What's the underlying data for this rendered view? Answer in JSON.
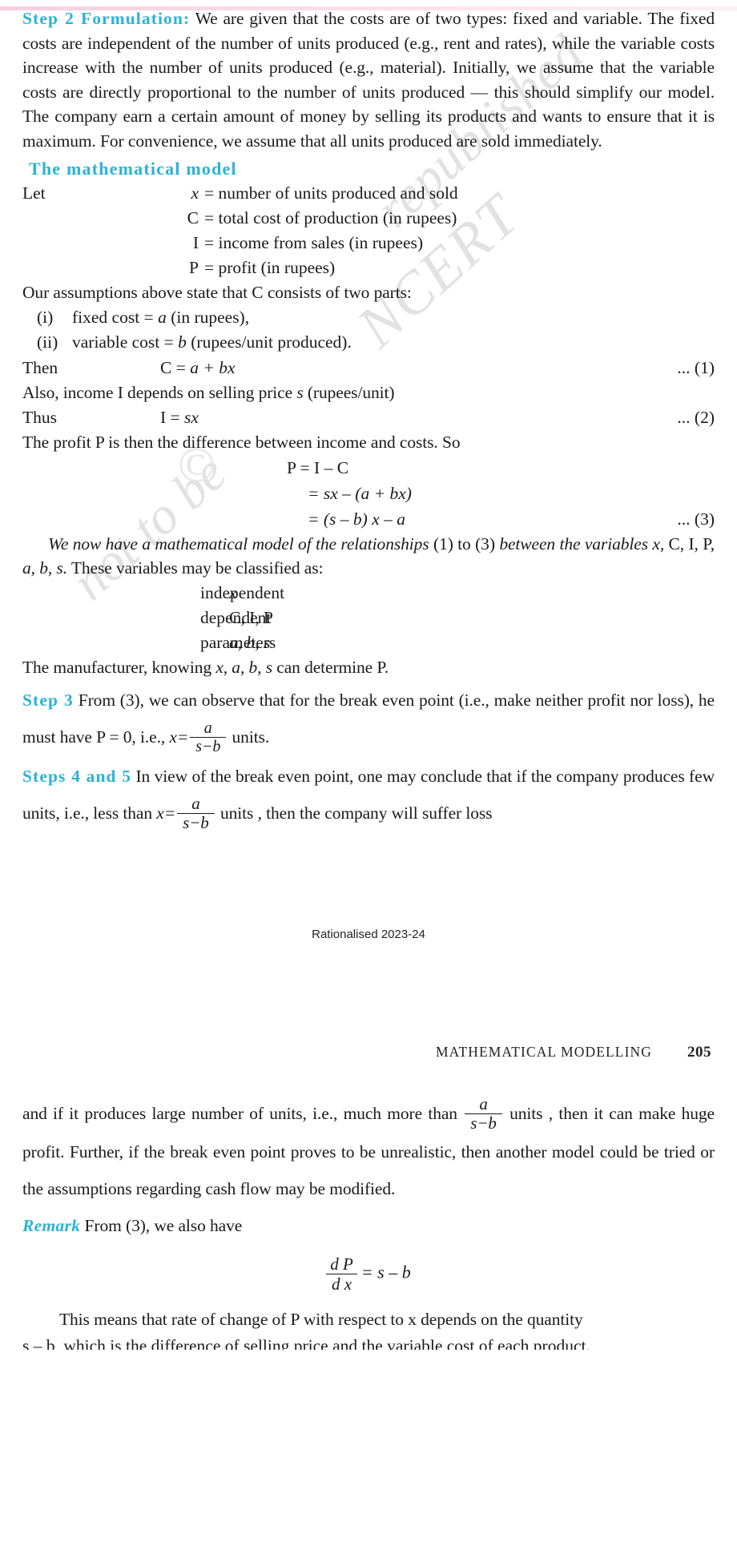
{
  "document": {
    "watermark": {
      "ncert": "NCERT",
      "republished": "republished",
      "not_to_be": "not to be",
      "copyright_symbol": "©"
    },
    "rationalised_note": "Rationalised 2023-24",
    "running_header": {
      "chapter_title": "MATHEMATICAL MODELLING",
      "page_number": "205"
    }
  },
  "step2": {
    "label": "Step 2 Formulation:",
    "body": " We are given that the costs are of two types: fixed and variable. The fixed costs are independent of the number of units produced (e.g., rent and rates), while the variable costs increase with the number of units produced (e.g., material). Initially, we assume that the variable costs are directly proportional to the number of units produced — this should simplify our model. The company earn a certain amount of money by selling its products and wants to ensure that it is maximum. For convenience, we assume that all units produced are sold immediately."
  },
  "model_section": {
    "heading": "The mathematical model",
    "let_label": "Let",
    "definitions": [
      {
        "symbol": "x",
        "symbol_italic": true,
        "eq": "=",
        "text": "number of units produced and sold"
      },
      {
        "symbol": "C",
        "symbol_italic": false,
        "eq": "=",
        "text": "total cost of production (in rupees)"
      },
      {
        "symbol": "I",
        "symbol_italic": false,
        "eq": "=",
        "text": "income from sales (in rupees)"
      },
      {
        "symbol": "P",
        "symbol_italic": false,
        "eq": "=",
        "text": "profit (in rupees)"
      }
    ],
    "assumptions_intro": "Our assumptions above state that C consists of two parts:",
    "assumptions": [
      {
        "marker": "(i)",
        "text_before": "fixed cost = ",
        "symbol": "a",
        "text_after": " (in rupees),"
      },
      {
        "marker": "(ii)",
        "text_before": "variable cost = ",
        "symbol": "b",
        "text_after": " (rupees/unit produced)."
      }
    ]
  },
  "equations": [
    {
      "lead": "Then",
      "lhs": "C = ",
      "rhs_italic": "a + bx",
      "tag": "... (1)"
    },
    {
      "lead": "Thus",
      "lhs": "I = ",
      "rhs_italic": "sx",
      "tag": "... (2)"
    }
  ],
  "income_line": {
    "before": "Also, income I depends on selling price ",
    "symbol": "s",
    "after": " (rupees/unit)"
  },
  "profit_intro": "The profit P is then the difference between income and costs. So",
  "profit_derivation": [
    {
      "text": "P = I – C",
      "tag": ""
    },
    {
      "text": "= sx – (a + bx)",
      "tag": ""
    },
    {
      "text": "= (s – b) x – a",
      "tag": "... (3)"
    }
  ],
  "model_summary": {
    "italic_part1": "We now have a mathematical model of the relationships",
    "refs": "(1)  to  (3)",
    "italic_part2": "between the variables x,",
    "vars_roman": "C, I, P,",
    "vars_italic": "a, b, s.",
    "tail": " These variables may be classified as:"
  },
  "classification": [
    {
      "kind": "independent",
      "vars": "x",
      "vars_italic": true
    },
    {
      "kind": "dependent",
      "vars": "C, I, P",
      "vars_italic": false
    },
    {
      "kind": "parameters",
      "vars": "a, b, s",
      "vars_italic": true
    }
  ],
  "manufacturer_line": {
    "before": "The manufacturer, knowing ",
    "symbols": "x, a, b, s",
    "after": " can determine P."
  },
  "step3": {
    "label": "Step 3",
    "body_part1": " From (3), we can observe that for the break even point (i.e., make neither profit nor loss), he must have P = 0, i.e., ",
    "eq_lhs": "x=",
    "frac_num": "a",
    "frac_den": "s−b",
    "body_part2": " units."
  },
  "steps45": {
    "label": "Steps 4 and 5",
    "body_part1": " In view of the break even point, one may conclude that if the company produces few units, i.e., less than ",
    "eq_lhs": "x=",
    "frac_num": "a",
    "frac_den": "s−b",
    "body_part2": " units ,  then the company will suffer loss"
  },
  "page2": {
    "cont_part1": "and if it produces large number of units, i.e., much more than ",
    "frac_num": "a",
    "frac_den": "s−b",
    "cont_part2": " units , then it can make huge profit. Further, if the break even point proves to be unrealistic, then another model could be tried or the assumptions regarding cash flow may be modified.",
    "remark_label": "Remark",
    "remark_body": " From (3), we also have",
    "derivative_eq": {
      "num": "d P",
      "den": "d x",
      "rhs": "= s – b"
    },
    "closing_para": "This means that rate of change of P with respect to x depends on the quantity",
    "clipped_line": "s – b, which is the difference of selling price and the variable cost of each product."
  }
}
